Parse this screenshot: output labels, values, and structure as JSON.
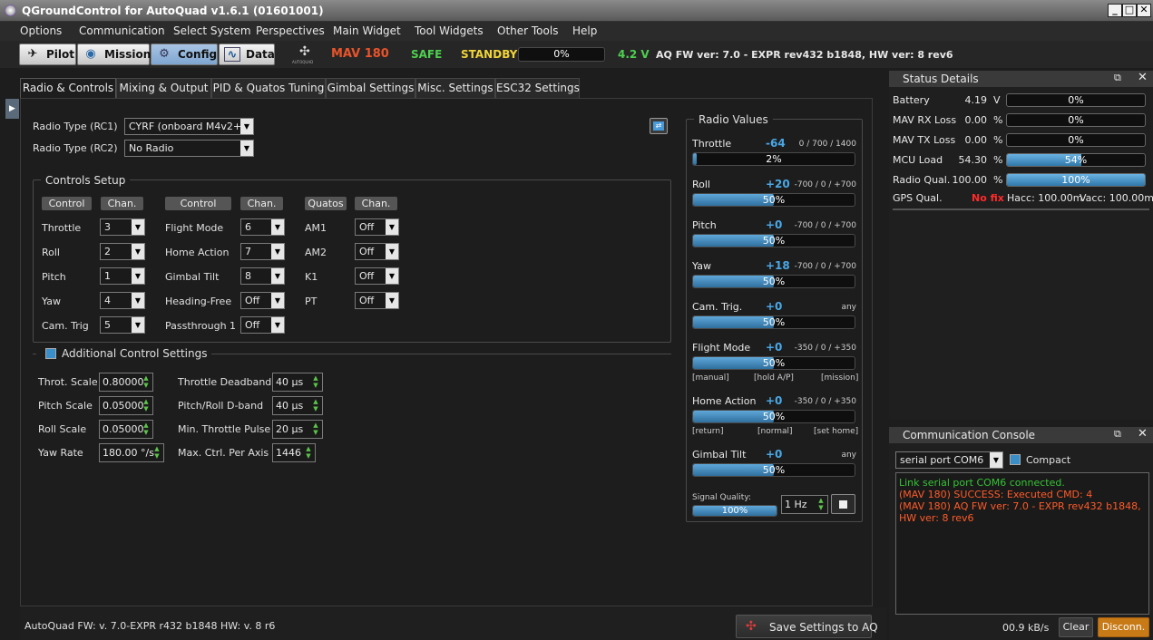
{
  "window": {
    "title": "QGroundControl for AutoQuad v1.6.1 (01601001)"
  },
  "menu": [
    "Options",
    "Communication",
    "Select System",
    "Perspectives",
    "Main Widget",
    "Tool Widgets",
    "Other Tools",
    "Help"
  ],
  "toolbar": {
    "pilot": "Pilot",
    "mission": "Mission",
    "config": "Config",
    "data": "Data",
    "logo_caption": "AUTOQUAD",
    "mav": "MAV 180",
    "safe": "SAFE",
    "standby": "STANDBY",
    "progress": "0%",
    "progress_value": 0,
    "voltage": "4.2 V",
    "fw": "AQ FW ver: 7.0 - EXPR rev432 b1848, HW ver: 8 rev6"
  },
  "tabs": [
    "Radio & Controls",
    "Mixing & Output",
    "PID & Quatos Tuning",
    "Gimbal Settings",
    "Misc. Settings",
    "ESC32 Settings"
  ],
  "radio": {
    "rc1_label": "Radio Type (RC1)",
    "rc1_value": "CYRF (onboard M4v2+)",
    "rc2_label": "Radio Type (RC2)",
    "rc2_value": "No Radio"
  },
  "controls": {
    "title": "Controls Setup",
    "hdr_control": "Control",
    "hdr_chan": "Chan.",
    "hdr_quatos": "Quatos",
    "col1": [
      {
        "label": "Throttle",
        "chan": "3"
      },
      {
        "label": "Roll",
        "chan": "2"
      },
      {
        "label": "Pitch",
        "chan": "1"
      },
      {
        "label": "Yaw",
        "chan": "4"
      },
      {
        "label": "Cam. Trig",
        "chan": "5"
      }
    ],
    "col2": [
      {
        "label": "Flight Mode",
        "chan": "6"
      },
      {
        "label": "Home Action",
        "chan": "7"
      },
      {
        "label": "Gimbal Tilt",
        "chan": "8"
      },
      {
        "label": "Heading-Free",
        "chan": "Off"
      },
      {
        "label": "Passthrough 1",
        "chan": "Off"
      }
    ],
    "col3": [
      {
        "label": "AM1",
        "chan": "Off"
      },
      {
        "label": "AM2",
        "chan": "Off"
      },
      {
        "label": "K1",
        "chan": "Off"
      },
      {
        "label": "PT",
        "chan": "Off"
      }
    ]
  },
  "additional": {
    "title": "Additional Control Settings",
    "left": [
      {
        "label": "Throt. Scale",
        "value": "0.80000"
      },
      {
        "label": "Pitch Scale",
        "value": "0.05000"
      },
      {
        "label": "Roll Scale",
        "value": "0.05000"
      },
      {
        "label": "Yaw Rate",
        "value": "180.00 °/s"
      }
    ],
    "right": [
      {
        "label": "Throttle Deadband",
        "value": "40 µs"
      },
      {
        "label": "Pitch/Roll D-band",
        "value": "40 µs"
      },
      {
        "label": "Min. Throttle Pulse",
        "value": "20 µs"
      },
      {
        "label": "Max. Ctrl. Per Axis",
        "value": "1446"
      }
    ]
  },
  "radio_values": {
    "title": "Radio Values",
    "items": [
      {
        "name": "Throttle",
        "value": "-64",
        "range": "0 / 700 / 1400",
        "pct": "2%",
        "fill": 2
      },
      {
        "name": "Roll",
        "value": "+20",
        "range": "-700 / 0 / +700",
        "pct": "50%",
        "fill": 50
      },
      {
        "name": "Pitch",
        "value": "+0",
        "range": "-700 / 0 / +700",
        "pct": "50%",
        "fill": 50
      },
      {
        "name": "Yaw",
        "value": "+18",
        "range": "-700 / 0 / +700",
        "pct": "50%",
        "fill": 50
      },
      {
        "name": "Cam. Trig.",
        "value": "+0",
        "range": "any",
        "pct": "50%",
        "fill": 50
      },
      {
        "name": "Flight Mode",
        "value": "+0",
        "range": "-350 / 0 / +350",
        "pct": "50%",
        "fill": 50
      },
      {
        "name": "Home Action",
        "value": "+0",
        "range": "-350 / 0 / +350",
        "pct": "50%",
        "fill": 50
      },
      {
        "name": "Gimbal Tilt",
        "value": "+0",
        "range": "any",
        "pct": "50%",
        "fill": 50
      }
    ],
    "fm_labels": [
      "[manual]",
      "[hold A/P]",
      "[mission]"
    ],
    "ha_labels": [
      "[return]",
      "[normal]",
      "[set home]"
    ],
    "signal_label": "Signal Quality:",
    "signal_pct": "100%",
    "signal_fill": 100,
    "rate": "1 Hz"
  },
  "footer": {
    "fw": "AutoQuad FW: v. 7.0-EXPR r432 b1848 HW: v. 8 r6",
    "save": "Save Settings to AQ"
  },
  "status": {
    "title": "Status Details",
    "rows": [
      {
        "label": "Battery",
        "value": "4.19",
        "unit": "V",
        "bar": "0%",
        "fill": 0
      },
      {
        "label": "MAV RX Loss",
        "value": "0.00",
        "unit": "%",
        "bar": "0%",
        "fill": 0
      },
      {
        "label": "MAV TX Loss",
        "value": "0.00",
        "unit": "%",
        "bar": "0%",
        "fill": 0
      },
      {
        "label": "MCU Load",
        "value": "54.30",
        "unit": "%",
        "bar": "54%",
        "fill": 54
      },
      {
        "label": "Radio Qual.",
        "value": "100.00",
        "unit": "%",
        "bar": "100%",
        "fill": 100
      }
    ],
    "gps_label": "GPS Qual.",
    "gps_value": "No fix",
    "hacc": "Hacc: 100.00m",
    "vacc": "Vacc: 100.00m"
  },
  "console": {
    "title": "Communication Console",
    "port": "serial port COM6",
    "compact": "Compact",
    "lines": [
      {
        "text": "Link serial port COM6 connected.",
        "color": "#35c335"
      },
      {
        "text": "(MAV 180) SUCCESS: Executed CMD: 4",
        "color": "#ff5a28"
      },
      {
        "text": "(MAV 180) AQ FW ver: 7.0 - EXPR rev432 b1848, HW ver: 8 rev6",
        "color": "#ff5a28"
      }
    ],
    "rate": "00.9 kB/s",
    "clear": "Clear",
    "disconnect": "Disconn."
  },
  "colors": {
    "mav": "#e8542a",
    "safe": "#4ed04e",
    "standby": "#f0d438",
    "voltage": "#4ed04e",
    "nofix": "#ff2a2a",
    "accent": "#4aa8e6"
  }
}
